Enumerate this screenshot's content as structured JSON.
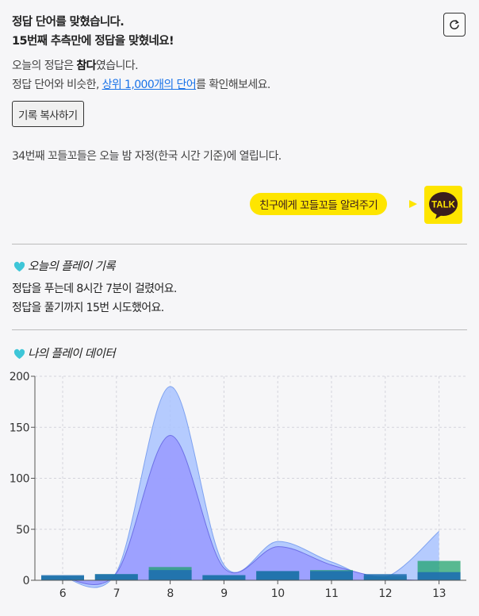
{
  "result": {
    "headline": "정답 단어를 맞혔습니다.",
    "subline": "15번째 추측만에 정답을 맞혔네요!",
    "answer_prefix": "오늘의 정답은 ",
    "answer_word": "참다",
    "answer_suffix": "였습니다.",
    "similar_prefix": "정답 단어와 비슷한, ",
    "similar_link": "상위 1,000개의 단어",
    "similar_suffix": "를 확인해보세요."
  },
  "copy_button_label": "기록 복사하기",
  "next_game_notice": "34번째 꼬들꼬들은 오늘 밤 자정(한국 시간 기준)에 열립니다.",
  "share": {
    "bubble_text": "친구에게 꼬들꼬들 알려주기",
    "kakao_label": "TALK"
  },
  "today_record": {
    "heading": "오늘의 플레이 기록",
    "time_line": "정답을 푸는데 8시간 7분이 걸렸어요.",
    "tries_line": "정답을 풀기까지 15번 시도했어요."
  },
  "my_data": {
    "heading": "나의 플레이 데이터"
  },
  "colors": {
    "kakao_yellow": "#fee500",
    "heart": "#3ec6d8",
    "area_light": "#a9c3ff",
    "area_dark": "#9a9cff",
    "bar_blue": "#1f6fb0",
    "bar_green": "#15a065",
    "link": "#1a73e8"
  },
  "chart_data": {
    "type": "area",
    "x": [
      6,
      7,
      8,
      9,
      10,
      11,
      12,
      13
    ],
    "x_tick_labels": [
      "6",
      "7",
      "8",
      "9",
      "10",
      "11",
      "12",
      "13"
    ],
    "y_tick_labels": [
      "200",
      "150",
      "100",
      "50",
      "0"
    ],
    "ylim": [
      0,
      200
    ],
    "grid": true,
    "series": [
      {
        "kind": "area",
        "values": [
          3,
          8,
          190,
          15,
          38,
          18,
          3,
          48
        ]
      },
      {
        "kind": "area",
        "values": [
          3,
          7,
          142,
          12,
          33,
          15,
          2,
          0
        ]
      },
      {
        "kind": "bar",
        "values": [
          4,
          6,
          13,
          5,
          9,
          10,
          4,
          19
        ]
      },
      {
        "kind": "bar",
        "values": [
          5,
          6,
          10,
          5,
          9,
          9,
          6,
          8
        ]
      }
    ]
  }
}
